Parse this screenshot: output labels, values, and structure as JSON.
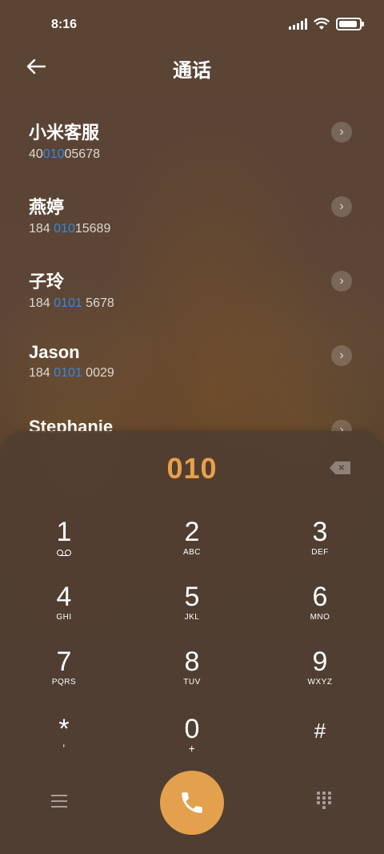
{
  "status_bar": {
    "time": "8:16"
  },
  "header": {
    "title": "通话"
  },
  "contacts": [
    {
      "name": "小米客服",
      "num_pre": "40",
      "num_hl": "010",
      "num_post": "05678"
    },
    {
      "name": "燕婷",
      "num_pre": "184 ",
      "num_hl": "010",
      "num_post": "15689"
    },
    {
      "name": "子玲",
      "num_pre": "184 ",
      "num_hl": "0101",
      "num_post": " 5678"
    },
    {
      "name": "Jason",
      "num_pre": "184 ",
      "num_hl": "0101",
      "num_post": " 0029"
    },
    {
      "name": "Stephanie",
      "num_pre": "",
      "num_hl": "",
      "num_post": ""
    }
  ],
  "dialer": {
    "typed": "010",
    "keys": [
      {
        "digit": "1",
        "letters": ""
      },
      {
        "digit": "2",
        "letters": "ABC"
      },
      {
        "digit": "3",
        "letters": "DEF"
      },
      {
        "digit": "4",
        "letters": "GHI"
      },
      {
        "digit": "5",
        "letters": "JKL"
      },
      {
        "digit": "6",
        "letters": "MNO"
      },
      {
        "digit": "7",
        "letters": "PQRS"
      },
      {
        "digit": "8",
        "letters": "TUV"
      },
      {
        "digit": "9",
        "letters": "WXYZ"
      },
      {
        "digit": "*",
        "letters": ","
      },
      {
        "digit": "0",
        "letters": "+"
      },
      {
        "digit": "#",
        "letters": ""
      }
    ]
  },
  "colors": {
    "accent": "#e3a14e",
    "typed": "#e8a04a",
    "highlight": "#2f8ae3"
  },
  "icons": {
    "back": "arrow-left-icon",
    "call": "phone-icon",
    "delete": "backspace-icon",
    "menu": "menu-icon",
    "keypad": "keypad-icon"
  }
}
